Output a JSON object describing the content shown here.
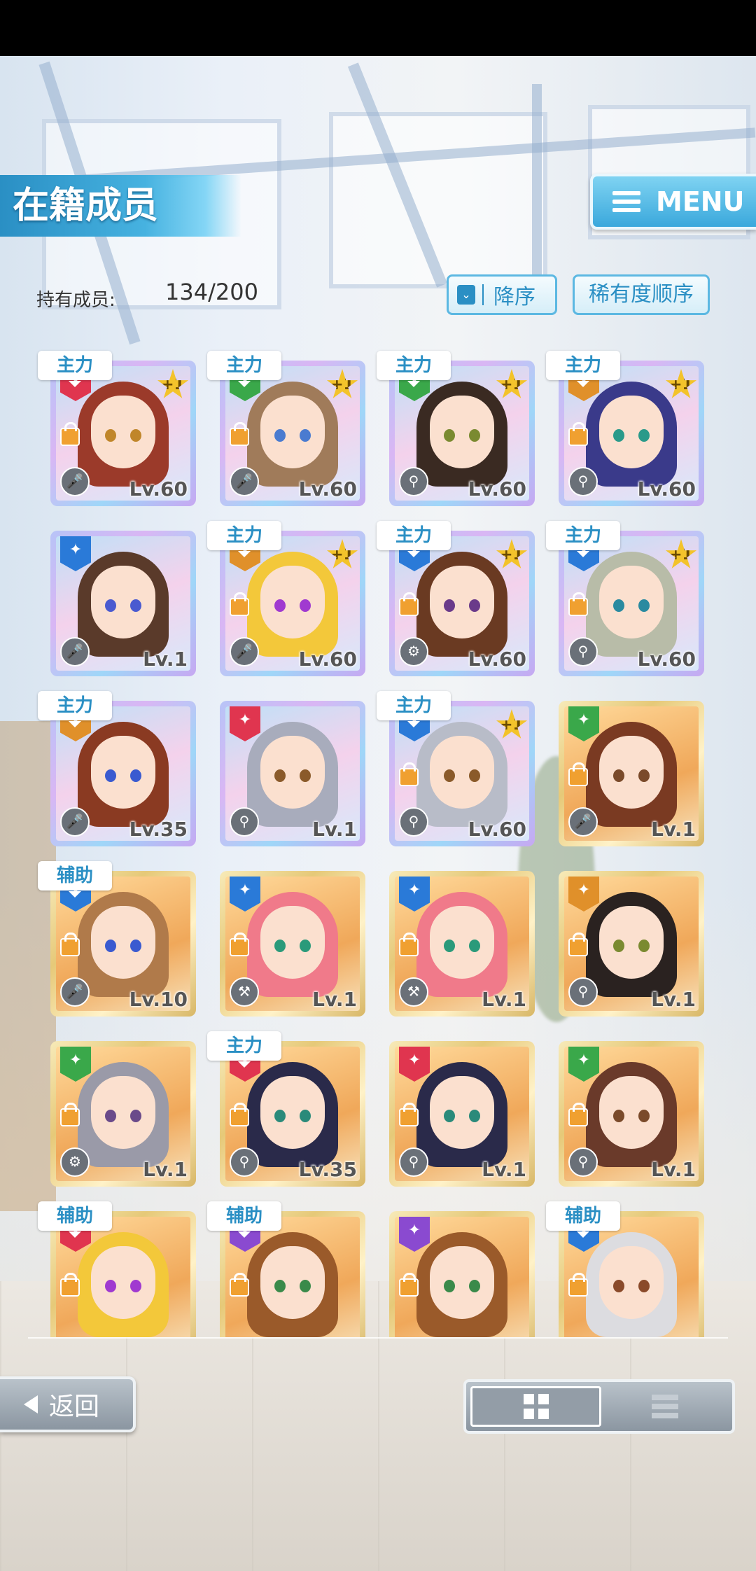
{
  "header": {
    "title": "在籍成员",
    "menu_label": "MENU"
  },
  "toolbar": {
    "count_label": "持有成员:",
    "count_value": "134/200",
    "sort_order_label": "降序",
    "sort_key_label": "稀有度顺序"
  },
  "colors": {
    "accent": "#2a8fc4",
    "role_tag_text": "#2a8fc4",
    "plus_badge": "#f3c32b"
  },
  "cards": [
    {
      "role": "主力",
      "level": "Lv.60",
      "plus": "+1",
      "frame": "purple",
      "hair": "#9b3a2a",
      "eye": "#c0862a",
      "flag": "#e0354f",
      "lock": true,
      "icon": "mic-icon"
    },
    {
      "role": "主力",
      "level": "Lv.60",
      "plus": "+1",
      "frame": "purple",
      "hair": "#a07b5a",
      "eye": "#4a7bd0",
      "flag": "#3aa84a",
      "lock": true,
      "icon": "mic-icon"
    },
    {
      "role": "主力",
      "level": "Lv.60",
      "plus": "+1",
      "frame": "purple",
      "hair": "#3a2a22",
      "eye": "#7a8a30",
      "flag": "#3aa84a",
      "lock": false,
      "icon": "mic-stand-icon"
    },
    {
      "role": "主力",
      "level": "Lv.60",
      "plus": "+1",
      "frame": "purple",
      "hair": "#3a3a8a",
      "eye": "#2a9a8a",
      "flag": "#e0902a",
      "lock": true,
      "icon": "mic-stand-icon"
    },
    {
      "role": "",
      "level": "Lv.1",
      "plus": "",
      "frame": "purple",
      "hair": "#5a3a2a",
      "eye": "#4a5ad0",
      "flag": "#2a7ad8",
      "lock": false,
      "icon": "mic-icon"
    },
    {
      "role": "主力",
      "level": "Lv.60",
      "plus": "+1",
      "frame": "purple",
      "hair": "#f3c83a",
      "eye": "#a03ad0",
      "flag": "#e0902a",
      "lock": true,
      "icon": "mic-icon"
    },
    {
      "role": "主力",
      "level": "Lv.60",
      "plus": "+1",
      "frame": "purple",
      "hair": "#6a3a22",
      "eye": "#6a3a8a",
      "flag": "#2a7ad8",
      "lock": true,
      "icon": "gear-icon"
    },
    {
      "role": "主力",
      "level": "Lv.60",
      "plus": "+1",
      "frame": "purple",
      "hair": "#b8bca8",
      "eye": "#2a8aa0",
      "flag": "#2a7ad8",
      "lock": true,
      "icon": "mic-stand-icon"
    },
    {
      "role": "主力",
      "level": "Lv.35",
      "plus": "",
      "frame": "purple",
      "hair": "#8a3a22",
      "eye": "#3a5ad0",
      "flag": "#e0902a",
      "lock": false,
      "icon": "mic-icon"
    },
    {
      "role": "",
      "level": "Lv.1",
      "plus": "",
      "frame": "purple",
      "hair": "#a8acbc",
      "eye": "#8a5a2a",
      "flag": "#e0354f",
      "lock": false,
      "icon": "mic-stand-icon"
    },
    {
      "role": "主力",
      "level": "Lv.60",
      "plus": "+1",
      "frame": "purple",
      "hair": "#b8bcc8",
      "eye": "#8a5a2a",
      "flag": "#2a7ad8",
      "lock": true,
      "icon": "mic-stand-icon"
    },
    {
      "role": "",
      "level": "Lv.1",
      "plus": "",
      "frame": "gold",
      "hair": "#7a3a22",
      "eye": "#7a4a2a",
      "flag": "#3aa84a",
      "lock": true,
      "icon": "mic-icon"
    },
    {
      "role": "辅助",
      "level": "Lv.10",
      "plus": "",
      "frame": "gold",
      "hair": "#b07a4a",
      "eye": "#3a5ad0",
      "flag": "#2a7ad8",
      "lock": true,
      "icon": "mic-icon"
    },
    {
      "role": "",
      "level": "Lv.1",
      "plus": "",
      "frame": "gold",
      "hair": "#f07a8a",
      "eye": "#2a9a7a",
      "flag": "#2a7ad8",
      "lock": true,
      "icon": "hammer-icon"
    },
    {
      "role": "",
      "level": "Lv.1",
      "plus": "",
      "frame": "gold",
      "hair": "#f07a8a",
      "eye": "#2a9a7a",
      "flag": "#2a7ad8",
      "lock": true,
      "icon": "hammer-icon"
    },
    {
      "role": "",
      "level": "Lv.1",
      "plus": "",
      "frame": "gold",
      "hair": "#2a2220",
      "eye": "#7a8a30",
      "flag": "#e0902a",
      "lock": true,
      "icon": "mic-stand-icon"
    },
    {
      "role": "",
      "level": "Lv.1",
      "plus": "",
      "frame": "gold",
      "hair": "#9a9aa8",
      "eye": "#6a4a8a",
      "flag": "#3aa84a",
      "lock": true,
      "icon": "gear-icon"
    },
    {
      "role": "主力",
      "level": "Lv.35",
      "plus": "",
      "frame": "gold",
      "hair": "#2a2a4a",
      "eye": "#2a8a7a",
      "flag": "#e0354f",
      "lock": true,
      "icon": "mic-stand-icon"
    },
    {
      "role": "",
      "level": "Lv.1",
      "plus": "",
      "frame": "gold",
      "hair": "#2a2a4a",
      "eye": "#2a8a7a",
      "flag": "#e0354f",
      "lock": true,
      "icon": "mic-stand-icon"
    },
    {
      "role": "",
      "level": "Lv.1",
      "plus": "",
      "frame": "gold",
      "hair": "#6a3a2a",
      "eye": "#7a4a2a",
      "flag": "#3aa84a",
      "lock": true,
      "icon": "mic-stand-icon"
    },
    {
      "role": "辅助",
      "level": "",
      "plus": "",
      "frame": "gold",
      "hair": "#f3c83a",
      "eye": "#a03ad0",
      "flag": "#e0354f",
      "lock": true,
      "icon": ""
    },
    {
      "role": "辅助",
      "level": "",
      "plus": "",
      "frame": "gold",
      "hair": "#9a5a2a",
      "eye": "#3a8a4a",
      "flag": "#8a4ad0",
      "lock": true,
      "icon": ""
    },
    {
      "role": "",
      "level": "",
      "plus": "",
      "frame": "gold",
      "hair": "#9a5a2a",
      "eye": "#3a8a4a",
      "flag": "#8a4ad0",
      "lock": true,
      "icon": ""
    },
    {
      "role": "辅助",
      "level": "",
      "plus": "",
      "frame": "gold",
      "hair": "#dcdce0",
      "eye": "#8a4a2a",
      "flag": "#2a7ad8",
      "lock": true,
      "icon": ""
    }
  ],
  "footer": {
    "back_label": "返回",
    "view_mode": "grid"
  }
}
